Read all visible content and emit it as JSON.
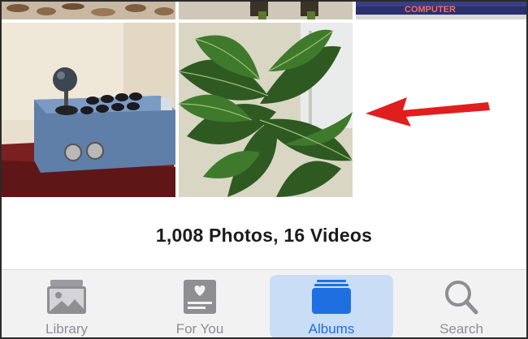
{
  "grid": {
    "photos_videos_count": "1,008 Photos, 16 Videos",
    "top_row_text": "COMPUTER"
  },
  "tabbar": {
    "tabs": [
      {
        "label": "Library",
        "icon": "photos-stack-icon"
      },
      {
        "label": "For You",
        "icon": "for-you-card-icon"
      },
      {
        "label": "Albums",
        "icon": "albums-folder-icon",
        "selected": true
      },
      {
        "label": "Search",
        "icon": "magnifying-glass-icon"
      }
    ],
    "active_color": "#1f6fe0",
    "inactive_color": "#8e8e93",
    "highlight_color": "#c9ddf7"
  },
  "annotation": {
    "arrow_color": "#e01e1e"
  }
}
